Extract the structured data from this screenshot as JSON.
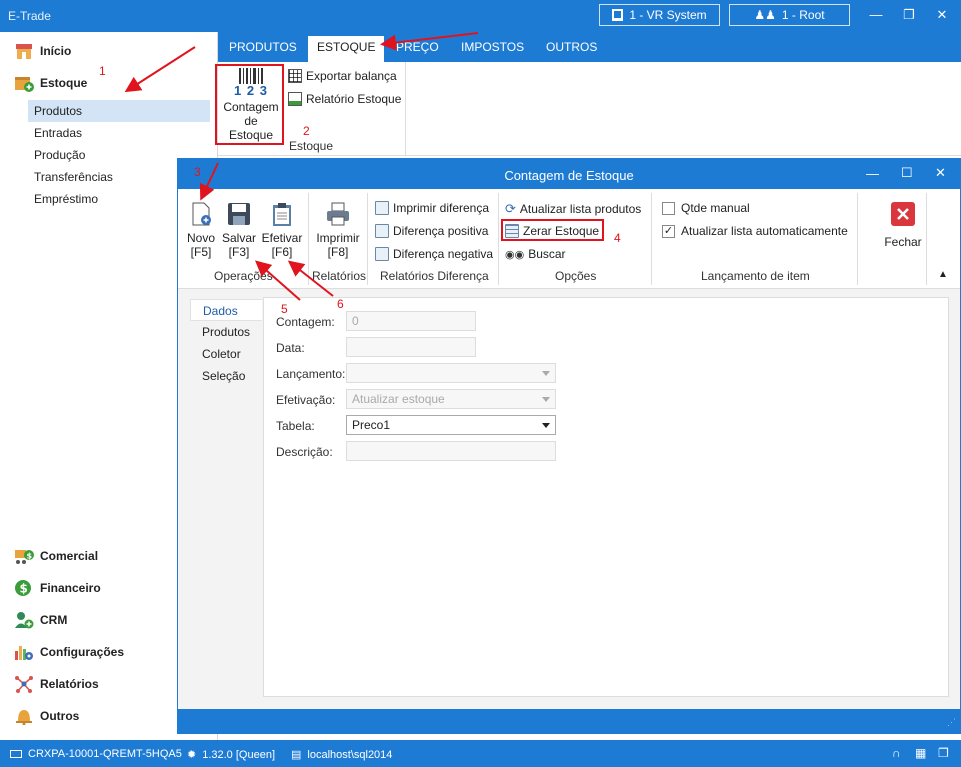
{
  "app": {
    "title": "E-Trade",
    "company": "1 - VR System",
    "user": "1 - Root"
  },
  "sidebar": {
    "top_modules": [
      {
        "label": "Início",
        "icon": "store-icon"
      },
      {
        "label": "Estoque",
        "icon": "box-add-icon"
      }
    ],
    "sub_items": [
      "Produtos",
      "Entradas",
      "Produção",
      "Transferências",
      "Empréstimo"
    ],
    "selected_sub": "Produtos",
    "bottom_modules": [
      {
        "label": "Comercial",
        "icon": "cart-dollar-icon"
      },
      {
        "label": "Financeiro",
        "icon": "dollar-circle-icon"
      },
      {
        "label": "CRM",
        "icon": "user-add-icon"
      },
      {
        "label": "Configurações",
        "icon": "chart-gear-icon"
      },
      {
        "label": "Relatórios",
        "icon": "network-icon"
      },
      {
        "label": "Outros",
        "icon": "bell-icon"
      }
    ]
  },
  "ribbon": {
    "tabs": [
      "PRODUTOS",
      "ESTOQUE",
      "PREÇO",
      "IMPOSTOS",
      "OUTROS"
    ],
    "active_tab": "ESTOQUE",
    "buttons": {
      "contagem": "Contagem de Estoque",
      "barcode_digits": "1 2 3",
      "exportar": "Exportar balança",
      "relatorio": "Relatório Estoque"
    },
    "group_label": "Estoque"
  },
  "dialog": {
    "title": "Contagem de Estoque",
    "operacoes": {
      "novo": "Novo",
      "novo_key": "[F5]",
      "salvar": "Salvar",
      "salvar_key": "[F3]",
      "efetivar": "Efetivar",
      "efetivar_key": "[F6]",
      "label": "Operações"
    },
    "relatorios": {
      "imprimir": "Imprimir",
      "imprimir_key": "[F8]",
      "label": "Relatórios"
    },
    "rel_diferenca": {
      "items": [
        "Imprimir diferença",
        "Diferença positiva",
        "Diferença negativa"
      ],
      "label": "Relatórios Diferença"
    },
    "opcoes": {
      "items": [
        "Atualizar lista produtos",
        "Zerar Estoque",
        "Buscar"
      ],
      "label": "Opções"
    },
    "lancamento": {
      "qtde_manual": "Qtde manual",
      "qtde_checked": false,
      "atualizar": "Atualizar lista automaticamente",
      "atualizar_checked": true,
      "label": "Lançamento de item"
    },
    "fechar": "Fechar",
    "nav": [
      "Dados",
      "Produtos",
      "Coletor",
      "Seleção"
    ],
    "nav_selected": "Dados",
    "form": {
      "contagem_label": "Contagem:",
      "contagem_value": "0",
      "data_label": "Data:",
      "data_value": "",
      "lancamento_label": "Lançamento:",
      "lancamento_value": "",
      "efetivacao_label": "Efetivação:",
      "efetivacao_value": "Atualizar estoque",
      "tabela_label": "Tabela:",
      "tabela_value": "Preco1",
      "descricao_label": "Descrição:",
      "descricao_value": ""
    }
  },
  "annotations": [
    "1",
    "2",
    "3",
    "4",
    "5",
    "6"
  ],
  "colors": {
    "accent": "#1e7bd4",
    "annotation": "#e0141e",
    "selected": "#d2e4f6"
  },
  "status": {
    "machine": "CRXPA-10001-QREMT-5HQA5",
    "version": "1.32.0 [Queen]",
    "server": "localhost\\sql2014"
  }
}
